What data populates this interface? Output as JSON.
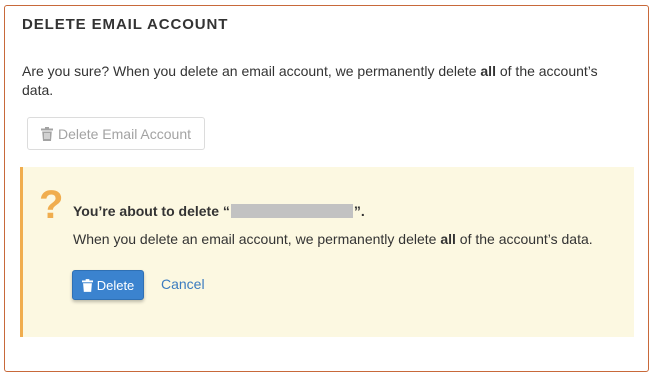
{
  "section": {
    "title": "DELETE EMAIL ACCOUNT",
    "intro": {
      "before": "Are you sure? When you delete an email account, we permanently delete ",
      "emphasis": "all",
      "after": " of the account’s data."
    },
    "disabled_button_label": "Delete Email Account"
  },
  "confirm": {
    "icon": "question-mark-icon",
    "heading_prefix": "You’re about to delete “",
    "heading_suffix": "”.",
    "body_before": "When you delete an email account, we permanently delete ",
    "body_emphasis": "all",
    "body_after": " of the account’s data.",
    "delete_label": "Delete",
    "cancel_label": "Cancel"
  },
  "colors": {
    "border": "#c8693a",
    "callout_bg": "#fcf8e1",
    "warning": "#f0ad4e",
    "primary": "#3b83cf",
    "link": "#3b7bbf"
  }
}
